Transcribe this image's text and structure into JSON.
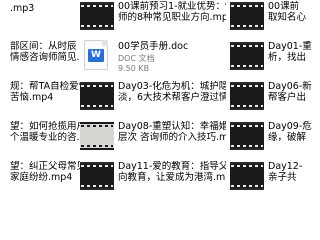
{
  "files": {
    "col0": [
      {
        "line1": ".mp3",
        "line2": ""
      },
      {
        "line1": "部区间：从时辰",
        "line2": "情感咨询师简见..."
      },
      {
        "line1": "规：帮TA自检爱情",
        "line2": "苦恼.mp4"
      },
      {
        "line1": "望：如何抢揽用户真",
        "line2": "个温暖专业的咨..."
      },
      {
        "line1": "望：纠正父母常见的",
        "line2": "家庭纷纷.mp4"
      }
    ],
    "col1": [
      {
        "line1": "00课前预习1-就业优势：情感咨询",
        "line2": "师的8种常见职业方向.mp4"
      },
      {
        "line1": "00学员手册.doc",
        "meta1": "DOC 文档",
        "meta2": "9.50 KB",
        "icon_label": "W"
      },
      {
        "line1": "Day03-化危为机：城护隐瞒的架冷",
        "line2": "淡，6大技术帮客户澄过情感危机..."
      },
      {
        "line1": "Day08-重塑认知：幸福婚姻的3个",
        "line2": "层次 咨询师的介入技巧.mp4"
      },
      {
        "line1": "Day11-爱的教育：指导父母进行正",
        "line2": "向教育，让爱成为港湾.mp4"
      }
    ],
    "col2": [
      {
        "line1": "00课前",
        "line2": "取知名心"
      },
      {
        "line1": "Day01-重",
        "line2": "析，找出"
      },
      {
        "line1": "Day06-新",
        "line2": "帮客户出"
      },
      {
        "line1": "Day09-危",
        "line2": "缘，破解"
      },
      {
        "line1": "Day12-",
        "line2": "亲子共"
      }
    ]
  }
}
